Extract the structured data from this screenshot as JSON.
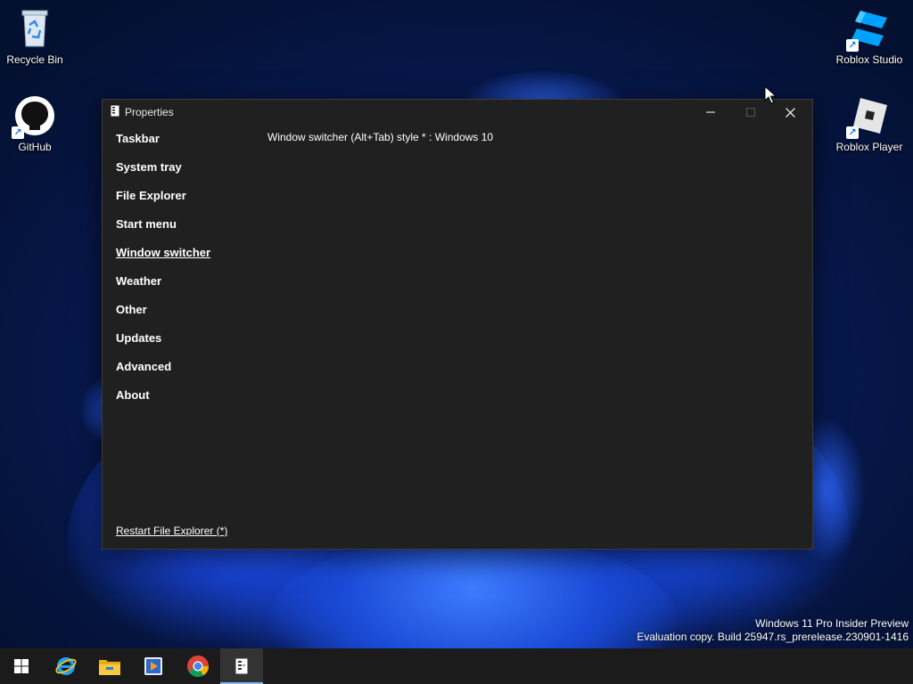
{
  "desktop": {
    "icons": [
      {
        "label": "Recycle Bin",
        "icon": "recycle-bin-icon"
      },
      {
        "label": "GitHub",
        "icon": "github-icon"
      },
      {
        "label": "Roblox Studio",
        "icon": "roblox-studio-icon"
      },
      {
        "label": "Roblox Player",
        "icon": "roblox-player-icon"
      }
    ],
    "watermark": {
      "line1": "Windows 11 Pro Insider Preview",
      "line2": "Evaluation copy. Build 25947.rs_prerelease.230901-1416"
    }
  },
  "window": {
    "title": "Properties",
    "nav_items": [
      {
        "label": "Taskbar"
      },
      {
        "label": "System tray"
      },
      {
        "label": "File Explorer"
      },
      {
        "label": "Start menu"
      },
      {
        "label": "Window switcher",
        "active": true
      },
      {
        "label": "Weather"
      },
      {
        "label": "Other"
      },
      {
        "label": "Updates"
      },
      {
        "label": "Advanced"
      },
      {
        "label": "About"
      }
    ],
    "setting": {
      "label": "Window switcher (Alt+Tab) style * : Windows 10"
    },
    "restart_link": "Restart File Explorer (*)"
  },
  "taskbar": {
    "items": [
      {
        "icon": "windows-start-icon"
      },
      {
        "icon": "internet-explorer-icon"
      },
      {
        "icon": "file-explorer-icon"
      },
      {
        "icon": "media-player-icon"
      },
      {
        "icon": "chrome-icon"
      },
      {
        "icon": "properties-app-icon",
        "active": true
      }
    ]
  },
  "colors": {
    "window_bg": "#202020",
    "taskbar_bg": "#1b1b1b",
    "active_indicator": "#7cb4ee"
  }
}
